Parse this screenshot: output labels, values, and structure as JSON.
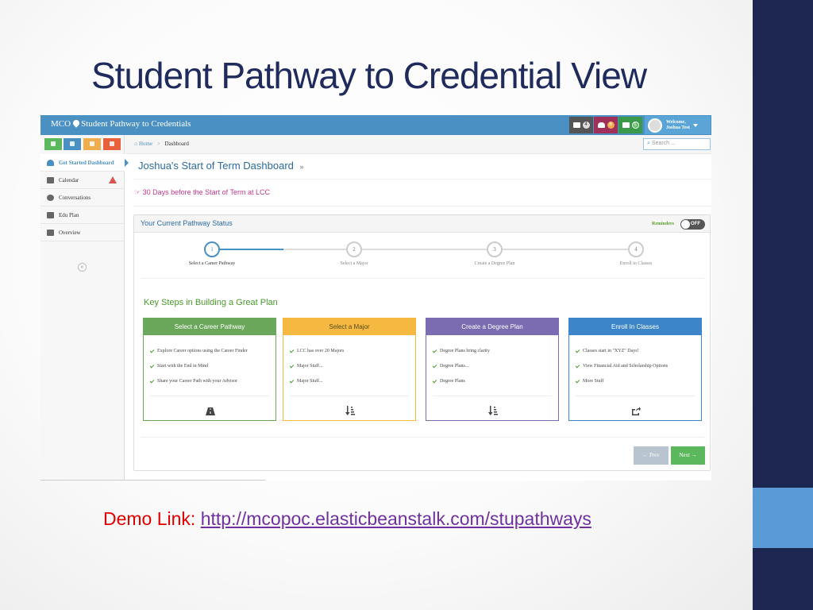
{
  "slide": {
    "title": "Student Pathway to Credential View",
    "demo_label": "Demo Link:",
    "demo_link": "http://mcopoc.elasticbeanstalk.com/stupathways",
    "colors": {
      "band": "#1e2752",
      "accent": "#5b9bd5",
      "title": "#1f2b5c"
    }
  },
  "app": {
    "brand": "MCO",
    "brand_title": "Student Pathway to Credentials",
    "toolbar": {
      "list_badge": "4",
      "alerts_badge": "8",
      "mail_badge": "5",
      "welcome": "Welcome,",
      "user_name": "Joshua Test"
    },
    "quick_buttons": [
      {
        "icon": "home-icon",
        "color": "#5cb85c"
      },
      {
        "icon": "road-icon",
        "color": "#4a90c2"
      },
      {
        "icon": "calendar-icon",
        "color": "#f0ad4e"
      },
      {
        "icon": "group-icon",
        "color": "#e8603c"
      }
    ],
    "nav": [
      {
        "label": "Get Started Dashboard",
        "icon": "dashboard-icon",
        "active": true
      },
      {
        "label": "Calendar",
        "icon": "calendar-icon",
        "warning": true
      },
      {
        "label": "Conversations",
        "icon": "comment-icon"
      },
      {
        "label": "Edu Plan",
        "icon": "image-icon"
      },
      {
        "label": "Overview",
        "icon": "image-icon"
      }
    ],
    "breadcrumb": {
      "home": "Home",
      "separator": ">",
      "current": "Dashboard"
    },
    "search_placeholder": "Search ...",
    "dashboard_title": "Joshua's Start of Term Dashboard",
    "dashboard_title_suffix": "»",
    "days_message": "30 Days before the Start of Term at LCC",
    "pathway": {
      "title": "Your Current Pathway Status",
      "reminders_label": "Reminders",
      "reminders_state": "OFF",
      "steps": [
        {
          "number": "1",
          "label": "Select a Career Pathway",
          "active": true
        },
        {
          "number": "2",
          "label": "Select a Major"
        },
        {
          "number": "3",
          "label": "Create a Degree Plan"
        },
        {
          "number": "4",
          "label": "Enroll in Classes"
        }
      ]
    },
    "key_steps_title": "Key Steps in Building a Great Plan",
    "cards": [
      {
        "title": "Select a Career Pathway",
        "color": "#6aa75a",
        "icon": "road-icon",
        "items": [
          "Explore Career options using the Career Finder",
          "Start with the End in Mind",
          "Share your Career Path with your Advisor"
        ]
      },
      {
        "title": "Select a Major",
        "color": "#f5b942",
        "icon": "sort-icon",
        "items": [
          "LCC has over 20 Majors",
          "Major Stuff...",
          "Major Stuff..."
        ]
      },
      {
        "title": "Create a Degree Plan",
        "color": "#7b6bb0",
        "icon": "sort-icon",
        "items": [
          "Degree Plans bring clarity",
          "Degree Plans...",
          "Degree Plans"
        ]
      },
      {
        "title": "Enroll In Classes",
        "color": "#3c85c9",
        "icon": "share-icon",
        "items": [
          "Classes start in \"XYZ\" Days!",
          "View Financial Aid and Scholarship Options",
          "More Stuff"
        ]
      }
    ],
    "prev_label": "← Prev",
    "next_label": "Next →"
  }
}
